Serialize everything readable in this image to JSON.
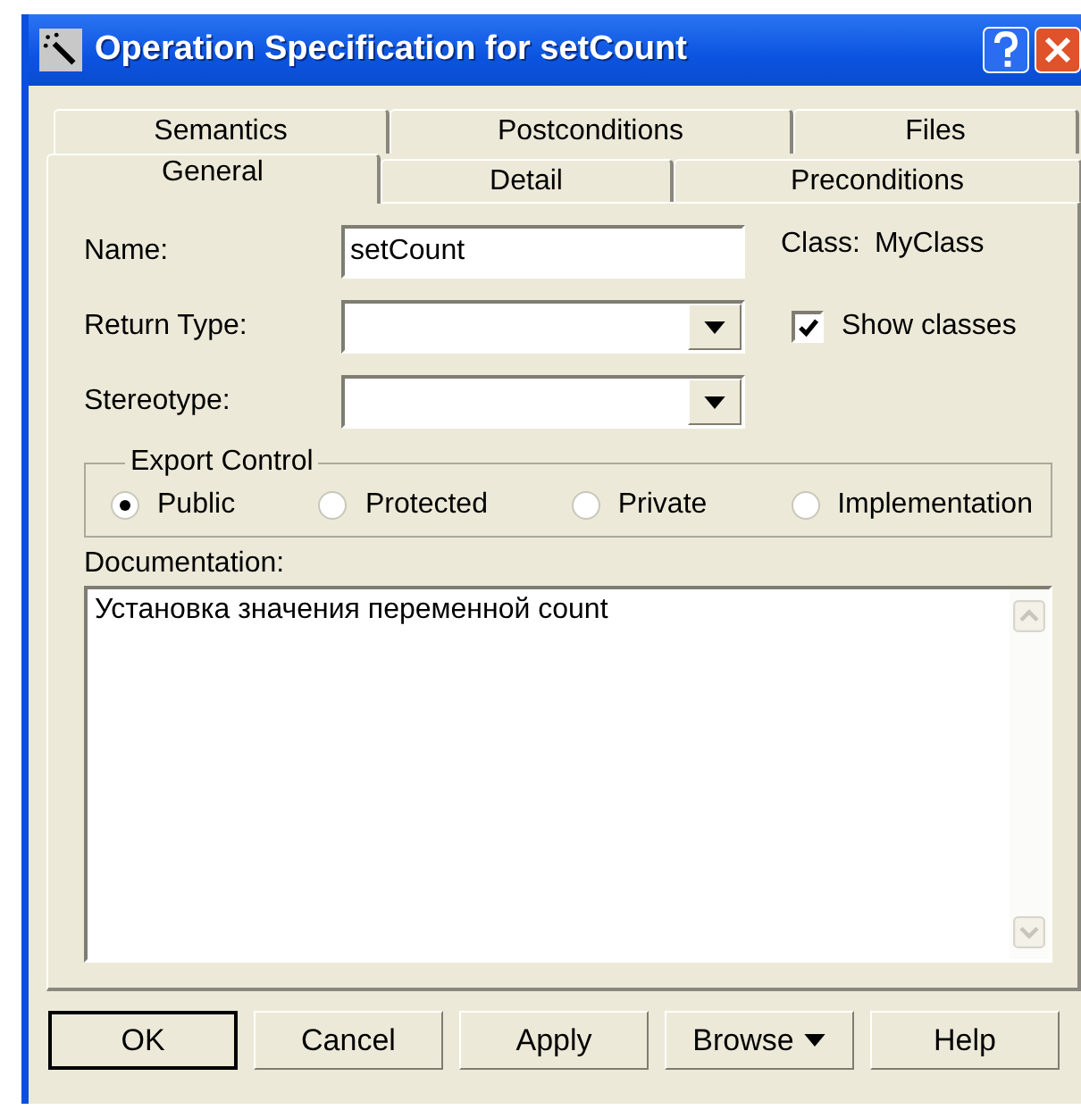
{
  "window": {
    "title": "Operation Specification for setCount"
  },
  "tab_rows": [
    [
      {
        "label": "Semantics",
        "selected": false
      },
      {
        "label": "Postconditions",
        "selected": false
      },
      {
        "label": "Files",
        "selected": false
      }
    ],
    [
      {
        "label": "General",
        "selected": true
      },
      {
        "label": "Detail",
        "selected": false
      },
      {
        "label": "Preconditions",
        "selected": false
      }
    ]
  ],
  "name_field": {
    "label": "Name:",
    "value": "setCount"
  },
  "class_label": "Class:",
  "class_value": "MyClass",
  "return_type": {
    "label": "Return Type:"
  },
  "show_classes": {
    "label": "Show classes",
    "checked": true
  },
  "stereotype": {
    "label": "Stereotype:"
  },
  "export_control": {
    "title": "Export Control",
    "options": [
      {
        "label": "Public",
        "selected": true
      },
      {
        "label": "Protected",
        "selected": false
      },
      {
        "label": "Private",
        "selected": false
      },
      {
        "label": "Implementation",
        "selected": false
      }
    ]
  },
  "documentation": {
    "label": "Documentation:",
    "value": "Установка значения переменной count"
  },
  "buttons": [
    {
      "label": "OK",
      "kind": "default"
    },
    {
      "label": "Cancel",
      "kind": "plain"
    },
    {
      "label": "Apply",
      "kind": "plain"
    },
    {
      "label": "Browse",
      "kind": "menu"
    },
    {
      "label": "Help",
      "kind": "plain"
    }
  ]
}
